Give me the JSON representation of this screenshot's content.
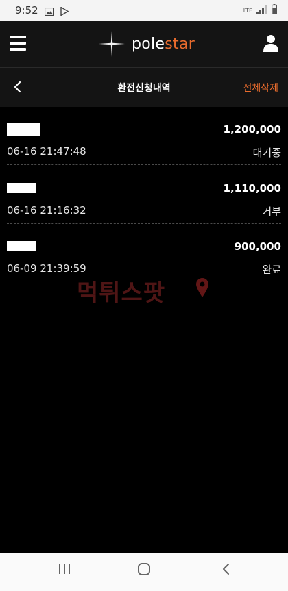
{
  "status_bar": {
    "time": "9:52",
    "network": "LTE",
    "icons": [
      "image-icon",
      "play-store-icon",
      "signal-icon",
      "battery-icon"
    ]
  },
  "header": {
    "logo_part1": "pole",
    "logo_part2": "star",
    "icons": [
      "menu-icon",
      "user-icon"
    ],
    "accent_color": "#e86b2d"
  },
  "sub_header": {
    "title": "환전신청내역",
    "delete_all_label": "전체삭제"
  },
  "requests": [
    {
      "amount": "1,200,000",
      "datetime": "06-16 21:47:48",
      "status": "대기중"
    },
    {
      "amount": "1,110,000",
      "datetime": "06-16 21:16:32",
      "status": "거부"
    },
    {
      "amount": "900,000",
      "datetime": "06-09 21:39:59",
      "status": "완료"
    }
  ],
  "watermark": "먹튀스팟",
  "nav_bar": {
    "icons": [
      "recent-apps-icon",
      "home-icon",
      "back-icon"
    ]
  }
}
